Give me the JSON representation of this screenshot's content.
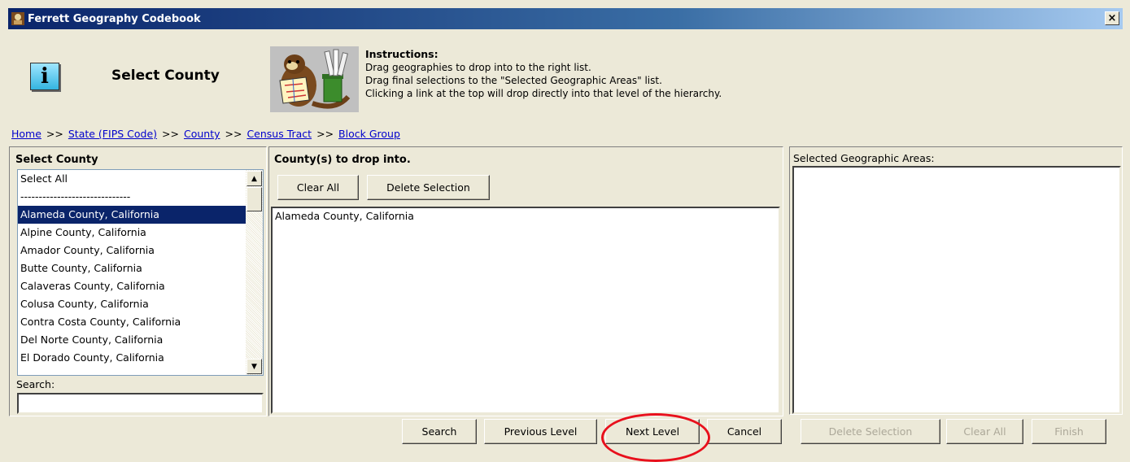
{
  "window": {
    "title": "Ferrett Geography Codebook",
    "close_label": "×"
  },
  "header": {
    "page_title": "Select County",
    "instructions_title": "Instructions:",
    "instructions": [
      "Drag geographies to drop into to the right list.",
      "Drag final selections to the \"Selected Geographic Areas\" list.",
      "Clicking a link at the top will drop directly into that level of the hierarchy."
    ]
  },
  "breadcrumb": {
    "items": [
      "Home",
      "State (FIPS Code)",
      "County",
      "Census Tract",
      "Block Group"
    ],
    "separator": ">>"
  },
  "left_panel": {
    "title": "Select County",
    "items": [
      "Select All",
      "------------------------------",
      "Alameda County, California",
      "Alpine County, California",
      "Amador County, California",
      "Butte County, California",
      "Calaveras County, California",
      "Colusa County, California",
      "Contra Costa County, California",
      "Del Norte County, California",
      "El Dorado County, California"
    ],
    "selected_item": "Alameda County, California",
    "search_label": "Search:",
    "search_value": ""
  },
  "middle_panel": {
    "title": "County(s) to drop into.",
    "clear_all_label": "Clear All",
    "delete_selection_label": "Delete Selection",
    "items": [
      "Alameda County, California"
    ]
  },
  "right_panel": {
    "title": "Selected Geographic Areas:",
    "items": []
  },
  "footer": {
    "search_label": "Search",
    "previous_level_label": "Previous Level",
    "next_level_label": "Next Level",
    "cancel_label": "Cancel",
    "delete_selection_label": "Delete Selection",
    "clear_all_label": "Clear All",
    "finish_label": "Finish"
  },
  "colors": {
    "titlebar_start": "#0a246a",
    "selection": "#0a246a",
    "link": "#0000cc",
    "highlight_ring": "#e8101c"
  }
}
